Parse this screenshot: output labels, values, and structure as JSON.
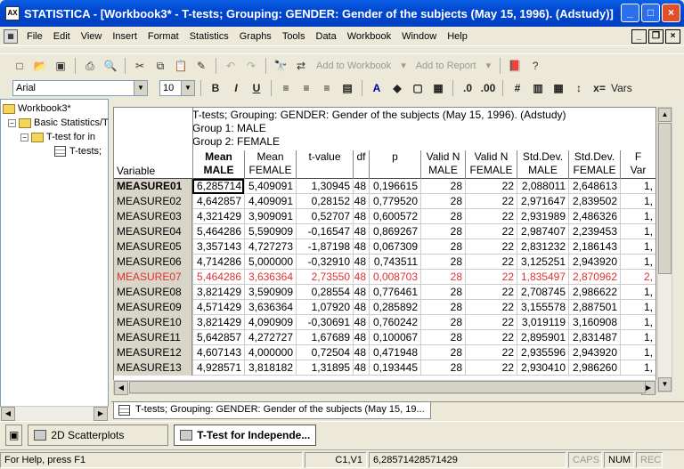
{
  "window": {
    "title": "STATISTICA - [Workbook3* - T-tests; Grouping: GENDER: Gender of the subjects (May 15, 1996). (Adstudy)]",
    "app_icon": "AX"
  },
  "menu": [
    "File",
    "Edit",
    "View",
    "Insert",
    "Format",
    "Statistics",
    "Graphs",
    "Tools",
    "Data",
    "Workbook",
    "Window",
    "Help"
  ],
  "toolbar": {
    "add_to_workbook": "Add to Workbook",
    "add_to_report": "Add to Report",
    "vars": "Vars",
    "font": "Arial",
    "font_size": "10",
    "bold": "B",
    "italic": "I",
    "underline": "U"
  },
  "tree": {
    "root": "Workbook3*",
    "child": "Basic Statistics/T",
    "sub": "T-test for in",
    "leaf": "T-tests;"
  },
  "sheet": {
    "title_lines": [
      "T-tests; Grouping: GENDER: Gender of the subjects (May 15, 1996). (Adstudy)",
      "Group 1: MALE",
      "Group 2: FEMALE"
    ],
    "var_header": "Variable",
    "columns": [
      {
        "l1": "Mean",
        "l2": "MALE",
        "bold": true
      },
      {
        "l1": "Mean",
        "l2": "FEMALE",
        "bold": false
      },
      {
        "l1": "t-value",
        "l2": "",
        "bold": false
      },
      {
        "l1": "df",
        "l2": "",
        "bold": false
      },
      {
        "l1": "p",
        "l2": "",
        "bold": false
      },
      {
        "l1": "Valid N",
        "l2": "MALE",
        "bold": false
      },
      {
        "l1": "Valid N",
        "l2": "FEMALE",
        "bold": false
      },
      {
        "l1": "Std.Dev.",
        "l2": "MALE",
        "bold": false
      },
      {
        "l1": "Std.Dev.",
        "l2": "FEMALE",
        "bold": false
      },
      {
        "l1": "F",
        "l2": "Var",
        "bold": false
      }
    ],
    "rows": [
      {
        "name": "MEASURE01",
        "red": false,
        "v": [
          "6,285714",
          "5,409091",
          "1,30945",
          "48",
          "0,196615",
          "28",
          "22",
          "2,088011",
          "2,648613",
          "1,"
        ]
      },
      {
        "name": "MEASURE02",
        "red": false,
        "v": [
          "4,642857",
          "4,409091",
          "0,28152",
          "48",
          "0,779520",
          "28",
          "22",
          "2,971647",
          "2,839502",
          "1,"
        ]
      },
      {
        "name": "MEASURE03",
        "red": false,
        "v": [
          "4,321429",
          "3,909091",
          "0,52707",
          "48",
          "0,600572",
          "28",
          "22",
          "2,931989",
          "2,486326",
          "1,"
        ]
      },
      {
        "name": "MEASURE04",
        "red": false,
        "v": [
          "5,464286",
          "5,590909",
          "-0,16547",
          "48",
          "0,869267",
          "28",
          "22",
          "2,987407",
          "2,239453",
          "1,"
        ]
      },
      {
        "name": "MEASURE05",
        "red": false,
        "v": [
          "3,357143",
          "4,727273",
          "-1,87198",
          "48",
          "0,067309",
          "28",
          "22",
          "2,831232",
          "2,186143",
          "1,"
        ]
      },
      {
        "name": "MEASURE06",
        "red": false,
        "v": [
          "4,714286",
          "5,000000",
          "-0,32910",
          "48",
          "0,743511",
          "28",
          "22",
          "3,125251",
          "2,943920",
          "1,"
        ]
      },
      {
        "name": "MEASURE07",
        "red": true,
        "v": [
          "5,464286",
          "3,636364",
          "2,73550",
          "48",
          "0,008703",
          "28",
          "22",
          "1,835497",
          "2,870962",
          "2,"
        ]
      },
      {
        "name": "MEASURE08",
        "red": false,
        "v": [
          "3,821429",
          "3,590909",
          "0,28554",
          "48",
          "0,776461",
          "28",
          "22",
          "2,708745",
          "2,986622",
          "1,"
        ]
      },
      {
        "name": "MEASURE09",
        "red": false,
        "v": [
          "4,571429",
          "3,636364",
          "1,07920",
          "48",
          "0,285892",
          "28",
          "22",
          "3,155578",
          "2,887501",
          "1,"
        ]
      },
      {
        "name": "MEASURE10",
        "red": false,
        "v": [
          "3,821429",
          "4,090909",
          "-0,30691",
          "48",
          "0,760242",
          "28",
          "22",
          "3,019119",
          "3,160908",
          "1,"
        ]
      },
      {
        "name": "MEASURE11",
        "red": false,
        "v": [
          "5,642857",
          "4,272727",
          "1,67689",
          "48",
          "0,100067",
          "28",
          "22",
          "2,895901",
          "2,831487",
          "1,"
        ]
      },
      {
        "name": "MEASURE12",
        "red": false,
        "v": [
          "4,607143",
          "4,000000",
          "0,72504",
          "48",
          "0,471948",
          "28",
          "22",
          "2,935596",
          "2,943920",
          "1,"
        ]
      },
      {
        "name": "MEASURE13",
        "red": false,
        "v": [
          "4,928571",
          "3,818182",
          "1,31895",
          "48",
          "0,193445",
          "28",
          "22",
          "2,930410",
          "2,986260",
          "1,"
        ]
      }
    ]
  },
  "tabbar": {
    "tab": "T-tests; Grouping: GENDER: Gender of the subjects (May 15, 19..."
  },
  "taskbar": {
    "item1": "2D Scatterplots",
    "item2": "T-Test for Independe..."
  },
  "status": {
    "help": "For Help, press F1",
    "cell": "C1,V1",
    "value": "6,28571428571429",
    "caps": "CAPS",
    "num": "NUM",
    "rec": "REC"
  }
}
